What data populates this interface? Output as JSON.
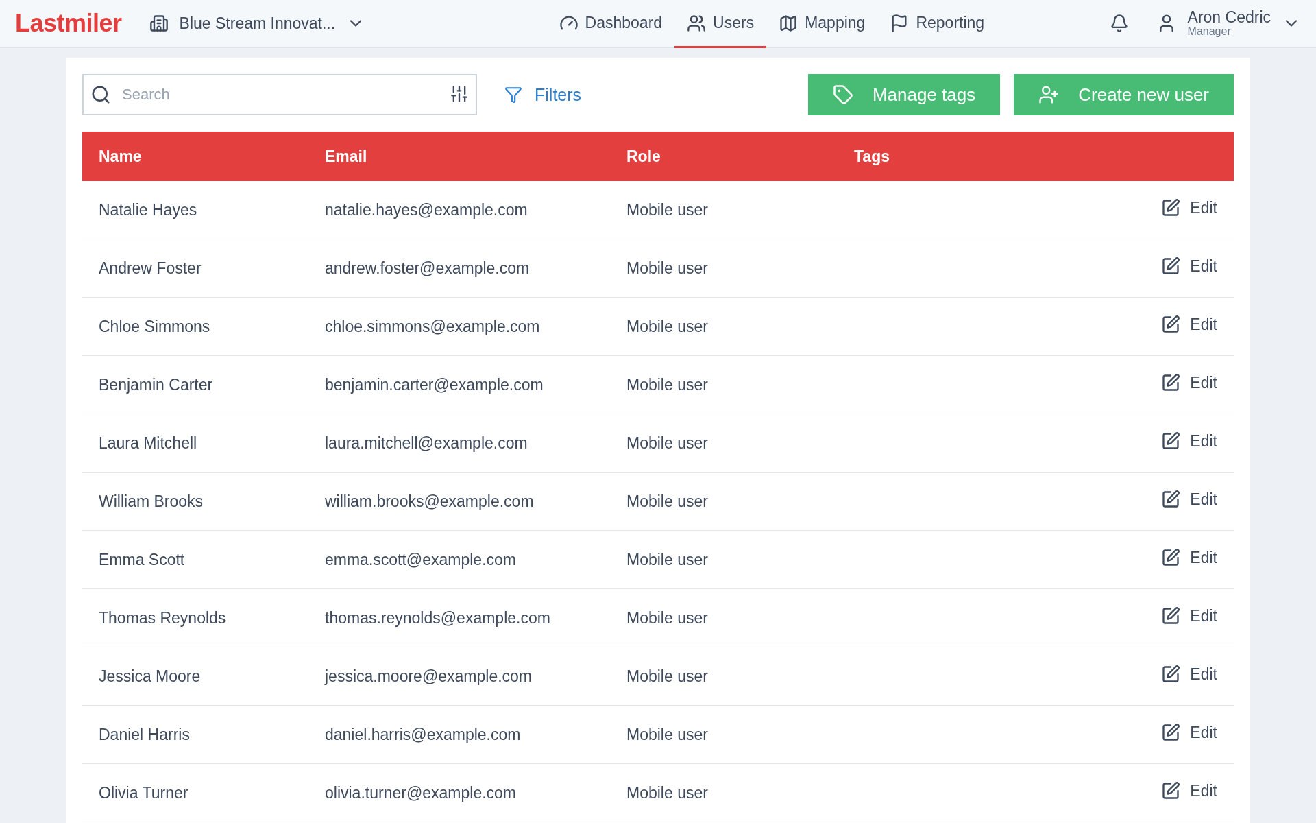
{
  "header": {
    "logo": "Lastmiler",
    "company": "Blue Stream Innovat...",
    "nav": [
      {
        "label": "Dashboard",
        "selected": false
      },
      {
        "label": "Users",
        "selected": true
      },
      {
        "label": "Mapping",
        "selected": false
      },
      {
        "label": "Reporting",
        "selected": false
      }
    ],
    "user": {
      "name": "Aron Cedric",
      "role": "Manager"
    }
  },
  "toolbar": {
    "search": {
      "placeholder": "Search"
    },
    "filters": "Filters",
    "buttons": [
      {
        "label": "Manage tags"
      },
      {
        "label": "Create new user"
      }
    ]
  },
  "table": {
    "columns": [
      "Name",
      "Email",
      "Role",
      "Tags"
    ],
    "rows": [
      {
        "name": "Natalie Hayes",
        "email": "natalie.hayes@example.com",
        "role": "Mobile user",
        "action": "Edit"
      },
      {
        "name": "Andrew Foster",
        "email": "andrew.foster@example.com",
        "role": "Mobile user",
        "action": "Edit"
      },
      {
        "name": "Chloe Simmons",
        "email": "chloe.simmons@example.com",
        "role": "Mobile user",
        "action": "Edit"
      },
      {
        "name": "Benjamin Carter",
        "email": "benjamin.carter@example.com",
        "role": "Mobile user",
        "action": "Edit"
      },
      {
        "name": "Laura Mitchell",
        "email": "laura.mitchell@example.com",
        "role": "Mobile user",
        "action": "Edit"
      },
      {
        "name": "William Brooks",
        "email": "william.brooks@example.com",
        "role": "Mobile user",
        "action": "Edit"
      },
      {
        "name": "Emma Scott",
        "email": "emma.scott@example.com",
        "role": "Mobile user",
        "action": "Edit"
      },
      {
        "name": "Thomas Reynolds",
        "email": "thomas.reynolds@example.com",
        "role": "Mobile user",
        "action": "Edit"
      },
      {
        "name": "Jessica Moore",
        "email": "jessica.moore@example.com",
        "role": "Mobile user",
        "action": "Edit"
      },
      {
        "name": "Daniel Harris",
        "email": "daniel.harris@example.com",
        "role": "Mobile user",
        "action": "Edit"
      },
      {
        "name": "Olivia Turner",
        "email": "olivia.turner@example.com",
        "role": "Mobile user",
        "action": "Edit"
      }
    ]
  }
}
